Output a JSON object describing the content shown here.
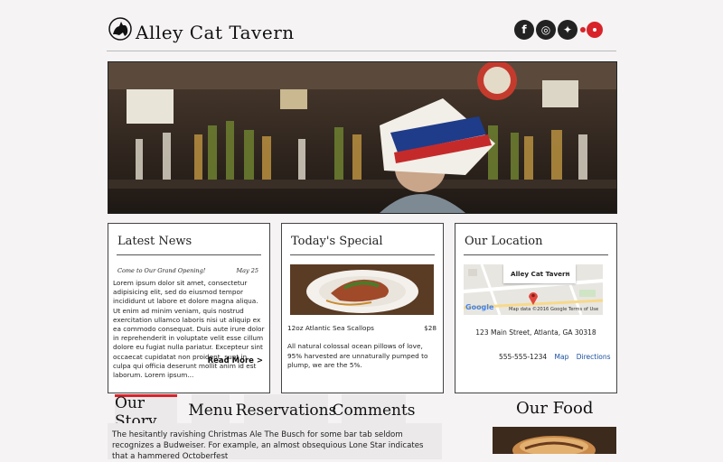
{
  "site": {
    "title": "Alley Cat Tavern"
  },
  "social": [
    {
      "name": "facebook-icon",
      "glyph": "f"
    },
    {
      "name": "instagram-icon",
      "glyph": "◎"
    },
    {
      "name": "twitter-icon",
      "glyph": "✦"
    }
  ],
  "news": {
    "title": "Latest News",
    "headline": "Come to Our Grand Opening!",
    "date": "May 25",
    "body": "Lorem ipsum dolor sit amet, consectetur adipisicing elit, sed do eiusmod tempor incididunt ut labore et dolore magna aliqua. Ut enim ad minim veniam, quis nostrud exercitation ullamco laboris nisi ut aliquip ex ea commodo consequat. Duis aute irure dolor in reprehenderit in voluptate velit esse cillum dolore eu fugiat nulla pariatur. Excepteur sint occaecat cupidatat non proident, sunt in culpa qui officia deserunt mollit anim id est laborum. Lorem ipsum...",
    "read_more": "Read More >"
  },
  "special": {
    "title": "Today's Special",
    "item": "12oz Atlantic Sea Scallops",
    "price": "$28",
    "description": "All natural colossal ocean pillows of love, 95% harvested are unnaturally pumped to plump, we are the 5%."
  },
  "location": {
    "title": "Our Location",
    "map_popup": "Alley Cat Tavern",
    "map_close": "✕",
    "map_logo": "Google",
    "map_attribution": "Map data ©2016 Google    Terms of Use",
    "address": "123 Main Street, Atlanta, GA 30318",
    "phone": "555-555-1234",
    "map_link": "Map",
    "directions_link": "Directions"
  },
  "tabs": [
    {
      "label": "Our Story",
      "active": true
    },
    {
      "label": "Menu",
      "active": false
    },
    {
      "label": "Reservations",
      "active": false
    },
    {
      "label": "Comments",
      "active": false
    }
  ],
  "story": {
    "text": "The hesitantly ravishing Christmas Ale The Busch for some bar tab seldom recognizes a Budweiser. For example, an almost obsequious Lone Star indicates that a hammered Octoberfest"
  },
  "food": {
    "title": "Our Food"
  },
  "colors": {
    "accent": "#d8232a",
    "link": "#1a4fa0",
    "dark": "#222222"
  }
}
